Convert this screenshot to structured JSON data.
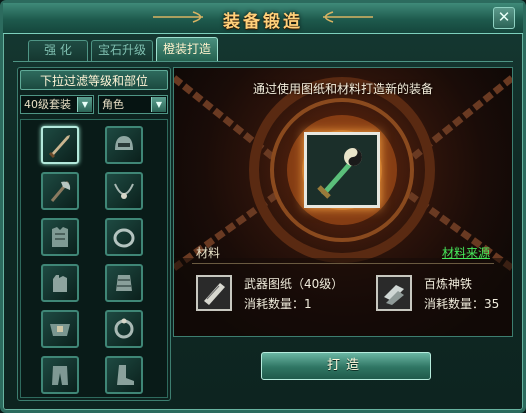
{
  "window": {
    "title": "装备锻造",
    "close_glyph": "✕"
  },
  "tabs": [
    {
      "label": "强  化",
      "active": false
    },
    {
      "label": "宝石升级",
      "active": false
    },
    {
      "label": "橙装打造",
      "active": true
    }
  ],
  "filter": {
    "header": "下拉过滤等级和部位",
    "level_select": {
      "value": "40级套装"
    },
    "part_select": {
      "value": "角色"
    },
    "arrow_glyph": "▼"
  },
  "equipment_slots": [
    {
      "icon": "dagger-icon",
      "selected": true
    },
    {
      "icon": "helmet-icon",
      "selected": false
    },
    {
      "icon": "axe-icon",
      "selected": false
    },
    {
      "icon": "necklace-icon",
      "selected": false
    },
    {
      "icon": "chest-armor-icon",
      "selected": false
    },
    {
      "icon": "ring-icon",
      "selected": false
    },
    {
      "icon": "gauntlet-icon",
      "selected": false
    },
    {
      "icon": "bracer-icon",
      "selected": false
    },
    {
      "icon": "belt-icon",
      "selected": false
    },
    {
      "icon": "bracelet-icon",
      "selected": false
    },
    {
      "icon": "pants-icon",
      "selected": false
    },
    {
      "icon": "boots-icon",
      "selected": false
    }
  ],
  "forge": {
    "hint": "通过使用图纸和材料打造新的装备",
    "result_icon": "jade-sword-icon",
    "materials_label": "材料",
    "materials_source_link": "材料来源",
    "materials": [
      {
        "icon": "blueprint-scroll-icon",
        "name": "武器图纸（40级）",
        "consume": "消耗数量：1"
      },
      {
        "icon": "refined-iron-icon",
        "name": "百炼神铁",
        "consume": "消耗数量：35"
      }
    ],
    "forge_button": "打造"
  },
  "colors": {
    "accent": "#2c6b5e",
    "title_gold": "#ffd07a",
    "link_green": "#46e85a"
  }
}
